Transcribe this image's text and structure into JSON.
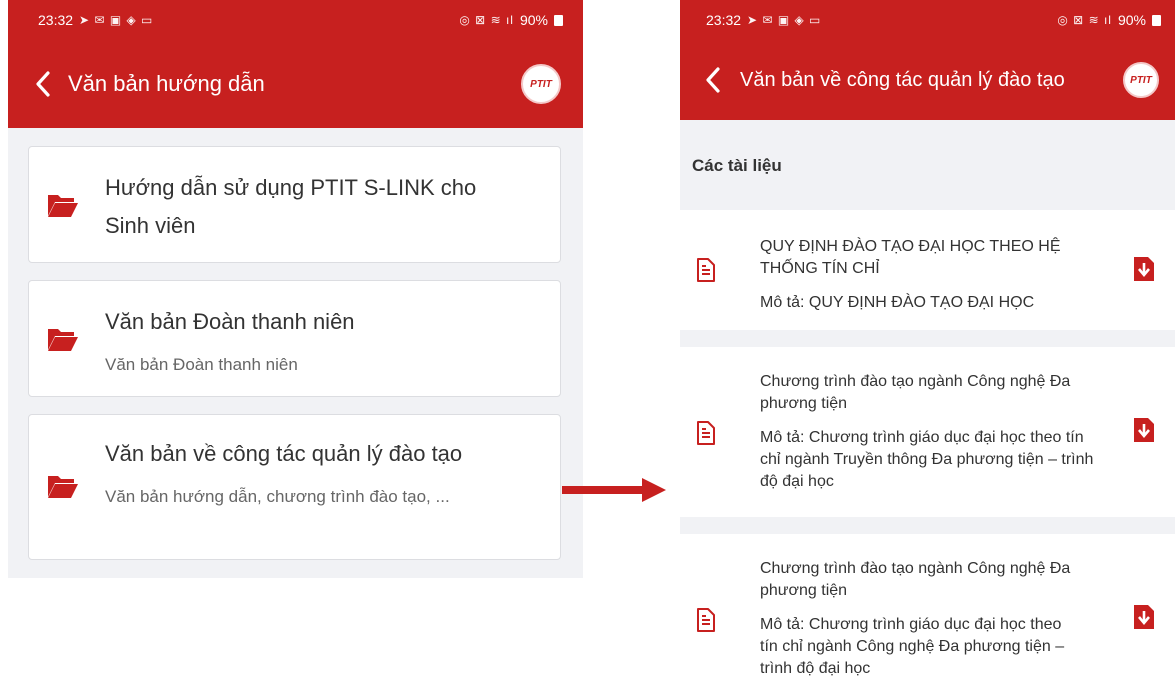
{
  "left_screen": {
    "status": {
      "time": "23:32",
      "battery": "90%"
    },
    "header": {
      "title": "Văn bản hướng dẫn",
      "logo": "PTIT"
    },
    "items": [
      {
        "title": "Hướng dẫn sử dụng PTIT S-LINK cho Sinh viên",
        "subtitle": ""
      },
      {
        "title": "Văn bản Đoàn thanh niên",
        "subtitle": "Văn bản Đoàn thanh niên"
      },
      {
        "title": "Văn bản về công tác quản lý đào tạo",
        "subtitle": "Văn bản hướng dẫn, chương trình đào tạo, ..."
      }
    ]
  },
  "right_screen": {
    "status": {
      "time": "23:32",
      "battery": "90%"
    },
    "header": {
      "title": "Văn bản về công tác quản lý đào tạo",
      "logo": "PTIT"
    },
    "section_label": "Các tài liệu",
    "documents": [
      {
        "title": "QUY ĐỊNH ĐÀO TẠO ĐẠI HỌC THEO HỆ THỐNG TÍN CHỈ",
        "description": "Mô tả: QUY ĐỊNH ĐÀO TẠO ĐẠI HỌC"
      },
      {
        "title": "Chương trình đào tạo ngành Công nghệ Đa phương tiện",
        "description": "Mô tả: Chương trình giáo dục đại học theo tín chỉ ngành Truyền thông Đa phương tiện – trình độ đại học"
      },
      {
        "title": "Chương trình đào tạo ngành Công nghệ Đa phương tiện",
        "description": "Mô tả: Chương trình giáo dục đại học theo tín chỉ ngành Công nghệ Đa phương tiện – trình độ đại học"
      }
    ]
  },
  "colors": {
    "brand_red": "#c7201f",
    "background": "#f1f2f5",
    "card": "#ffffff"
  },
  "icons": [
    "back-arrow-icon",
    "folder-icon",
    "document-icon",
    "pdf-download-icon",
    "battery-icon"
  ]
}
